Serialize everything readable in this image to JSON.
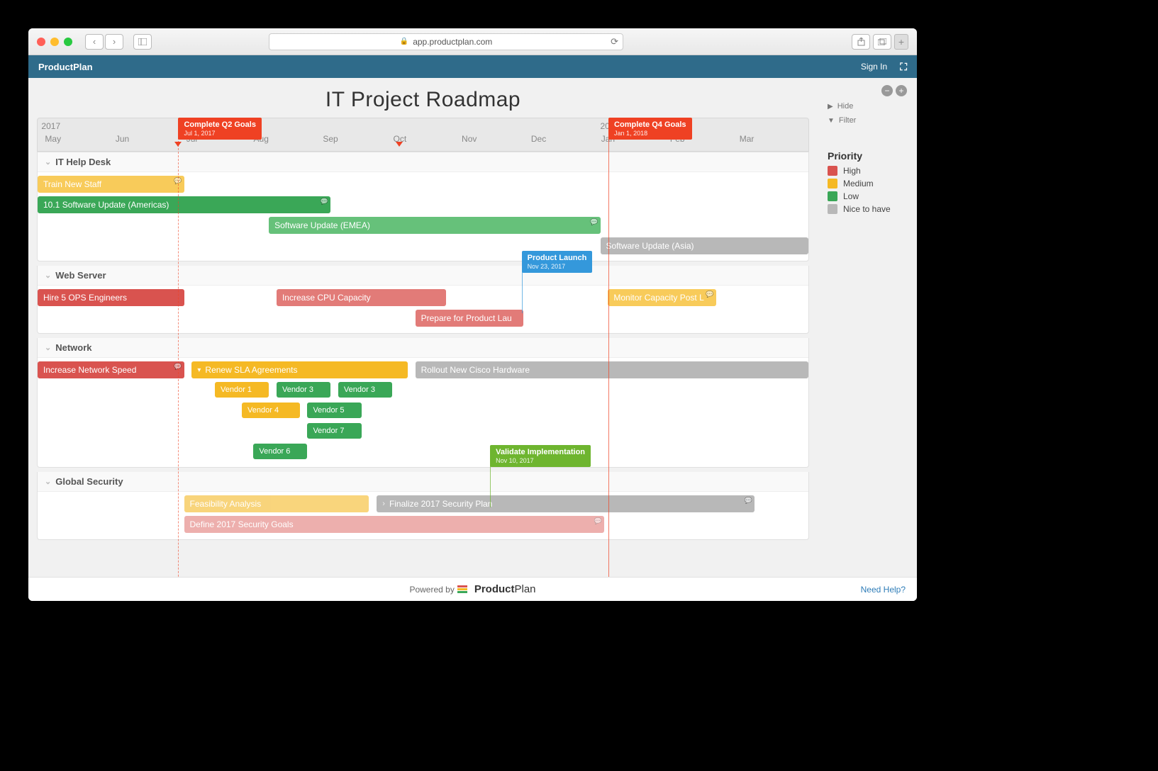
{
  "browser": {
    "url": "app.productplan.com"
  },
  "app": {
    "brand": "ProductPlan",
    "signin": "Sign In"
  },
  "page": {
    "title": "IT Project Roadmap"
  },
  "timeline": {
    "years": [
      {
        "label": "2017",
        "pct": 0.5
      },
      {
        "label": "2018",
        "pct": 73
      }
    ],
    "months": [
      {
        "label": "May",
        "pct": 2
      },
      {
        "label": "Jun",
        "pct": 11
      },
      {
        "label": "Jul",
        "pct": 20
      },
      {
        "label": "Aug",
        "pct": 29
      },
      {
        "label": "Sep",
        "pct": 38
      },
      {
        "label": "Oct",
        "pct": 47
      },
      {
        "label": "Nov",
        "pct": 56
      },
      {
        "label": "Dec",
        "pct": 65
      },
      {
        "label": "Jan",
        "pct": 74
      },
      {
        "label": "Feb",
        "pct": 83
      },
      {
        "label": "Mar",
        "pct": 92
      }
    ]
  },
  "milestones": [
    {
      "name": "Complete Q2 Goals",
      "date": "Jul 1, 2017",
      "pct": 19,
      "color": "red",
      "dashed": true,
      "marker": true
    },
    {
      "name": "Complete Q4 Goals",
      "date": "Jan 1, 2018",
      "pct": 73.5,
      "color": "red"
    },
    {
      "name": "Product Launch",
      "date": "Nov 23, 2017",
      "pct": 62.5,
      "color": "blue",
      "laneTop": 188
    },
    {
      "name": "Validate Implementation",
      "date": "Nov 10, 2017",
      "pct": 58.5,
      "color": "green",
      "laneTop": 462
    }
  ],
  "today_marker_pct": 47,
  "lanes": [
    {
      "name": "IT Help Desk",
      "rows": [
        [
          {
            "label": "Train New Staff",
            "start": 0,
            "end": 19,
            "cls": "c-yellow-l",
            "note": true
          }
        ],
        [
          {
            "label": "10.1 Software Update (Americas)",
            "start": 0,
            "end": 38,
            "cls": "c-green",
            "note": true
          }
        ],
        [
          {
            "label": "Software Update (EMEA)",
            "start": 30,
            "end": 73,
            "cls": "c-green-l",
            "note": true
          }
        ],
        [
          {
            "label": "Software Update (Asia)",
            "start": 73,
            "end": 100,
            "cls": "c-gray"
          }
        ]
      ]
    },
    {
      "name": "Web Server",
      "rows": [
        [
          {
            "label": "Hire 5 OPS Engineers",
            "start": 0,
            "end": 19,
            "cls": "c-red"
          },
          {
            "label": "Increase CPU Capacity",
            "start": 31,
            "end": 53,
            "cls": "c-red-l"
          },
          {
            "label": "Monitor Capacity Post L",
            "start": 74,
            "end": 88,
            "cls": "c-yellow-l",
            "note": true
          }
        ],
        [
          {
            "label": "Prepare for Product Lau",
            "start": 49,
            "end": 63,
            "cls": "c-red-l"
          }
        ]
      ]
    },
    {
      "name": "Network",
      "rows": [
        [
          {
            "label": "Increase Network Speed",
            "start": 0,
            "end": 19,
            "cls": "c-red",
            "note": true
          },
          {
            "container": true,
            "label": "Renew SLA Agreements",
            "start": 20,
            "end": 48,
            "cls": "c-yellow",
            "expanded": true
          },
          {
            "label": "Rollout New Cisco Hardware",
            "start": 49,
            "end": 100,
            "cls": "c-gray"
          }
        ],
        [
          {
            "label": "Vendor 1",
            "start": 23,
            "end": 30,
            "cls": "c-yellow",
            "sub": true
          },
          {
            "label": "Vendor 3",
            "start": 31,
            "end": 38,
            "cls": "c-green",
            "sub": true
          },
          {
            "label": "Vendor 3",
            "start": 39,
            "end": 46,
            "cls": "c-green",
            "sub": true
          }
        ],
        [
          {
            "label": "Vendor 4",
            "start": 26.5,
            "end": 34,
            "cls": "c-yellow",
            "sub": true
          },
          {
            "label": "Vendor 5",
            "start": 35,
            "end": 42,
            "cls": "c-green",
            "sub": true
          }
        ],
        [
          {
            "label": "Vendor 7",
            "start": 35,
            "end": 42,
            "cls": "c-green",
            "sub": true
          }
        ],
        [
          {
            "label": "Vendor 6",
            "start": 28,
            "end": 35,
            "cls": "c-green",
            "sub": true
          }
        ]
      ]
    },
    {
      "name": "Global Security",
      "rows": [
        [
          {
            "label": "Feasibility Analysis",
            "start": 19,
            "end": 43,
            "cls": "c-yellow",
            "faded": true
          },
          {
            "label": "Finalize 2017 Security Plan",
            "start": 44,
            "end": 93,
            "cls": "c-gray",
            "chev": true,
            "note": true
          }
        ],
        [
          {
            "label": "Define 2017 Security Goals",
            "start": 19,
            "end": 73.5,
            "cls": "c-red-l",
            "faded": true,
            "note": true
          }
        ]
      ]
    }
  ],
  "side": {
    "hide": "Hide",
    "filter": "Filter",
    "priority_title": "Priority",
    "legend": [
      {
        "label": "High",
        "color": "#d9534f"
      },
      {
        "label": "Medium",
        "color": "#f5b924"
      },
      {
        "label": "Low",
        "color": "#3aa757"
      },
      {
        "label": "Nice to have",
        "color": "#b8b8b8"
      }
    ]
  },
  "footer": {
    "powered": "Powered by",
    "brand": "ProductPlan",
    "help": "Need Help?"
  }
}
